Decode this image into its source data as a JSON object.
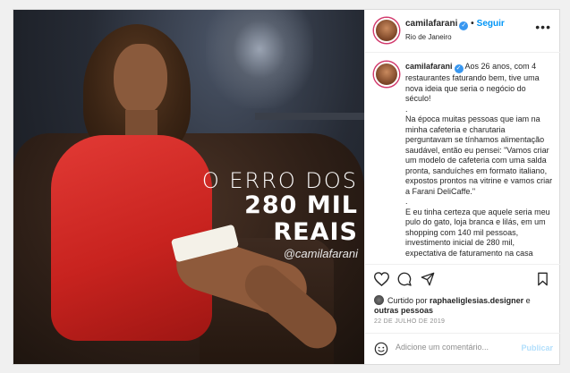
{
  "post": {
    "image": {
      "overlay_line1": "O ERRO DOS",
      "overlay_line2": "280 MIL REAIS",
      "overlay_handle": "@camilafarani"
    },
    "header": {
      "username": "camilafarani",
      "follow_label": "Seguir",
      "location": "Rio de Janeiro",
      "more_icon": "more-options-icon"
    },
    "caption": {
      "username": "camilafarani",
      "paragraph1": "Aos 26 anos, com 4 restaurantes faturando bem, tive uma nova ideia que seria o negócio do século!",
      "dot1": ".",
      "paragraph2": "Na época muitas pessoas que iam na minha cafeteria e charutaria  perguntavam se tínhamos alimentação saudável, então eu pensei: \"Vamos criar um modelo de cafeteria com uma salda pronta, sanduíches em formato italiano, expostos prontos na vitrine e vamos criar a Farani DeliCaffe.\"",
      "dot2": ".",
      "paragraph3": "E eu tinha certeza que aquele seria meu pulo do gato, loja branca e lilás, em um shopping com 140 mil pessoas, investimento inicial de 280 mil, expectativa de faturamento na casa"
    },
    "actions": {
      "icons": [
        "heart-icon",
        "comment-icon",
        "share-icon",
        "bookmark-icon"
      ],
      "liked_prefix": "Curtido por",
      "liked_user": "raphaeliglesias.designer",
      "liked_connector": "e",
      "liked_others": "outras pessoas",
      "date": "22 DE JULHO DE 2019"
    },
    "comment": {
      "emoji_icon": "emoji-icon",
      "placeholder": "Adicione um comentário...",
      "post_label": "Publicar"
    },
    "colors": {
      "link_blue": "#0095f6",
      "verified_blue": "#3897f0",
      "publish_disabled": "#b2dffc",
      "story_ring": "#d23a6d"
    }
  }
}
